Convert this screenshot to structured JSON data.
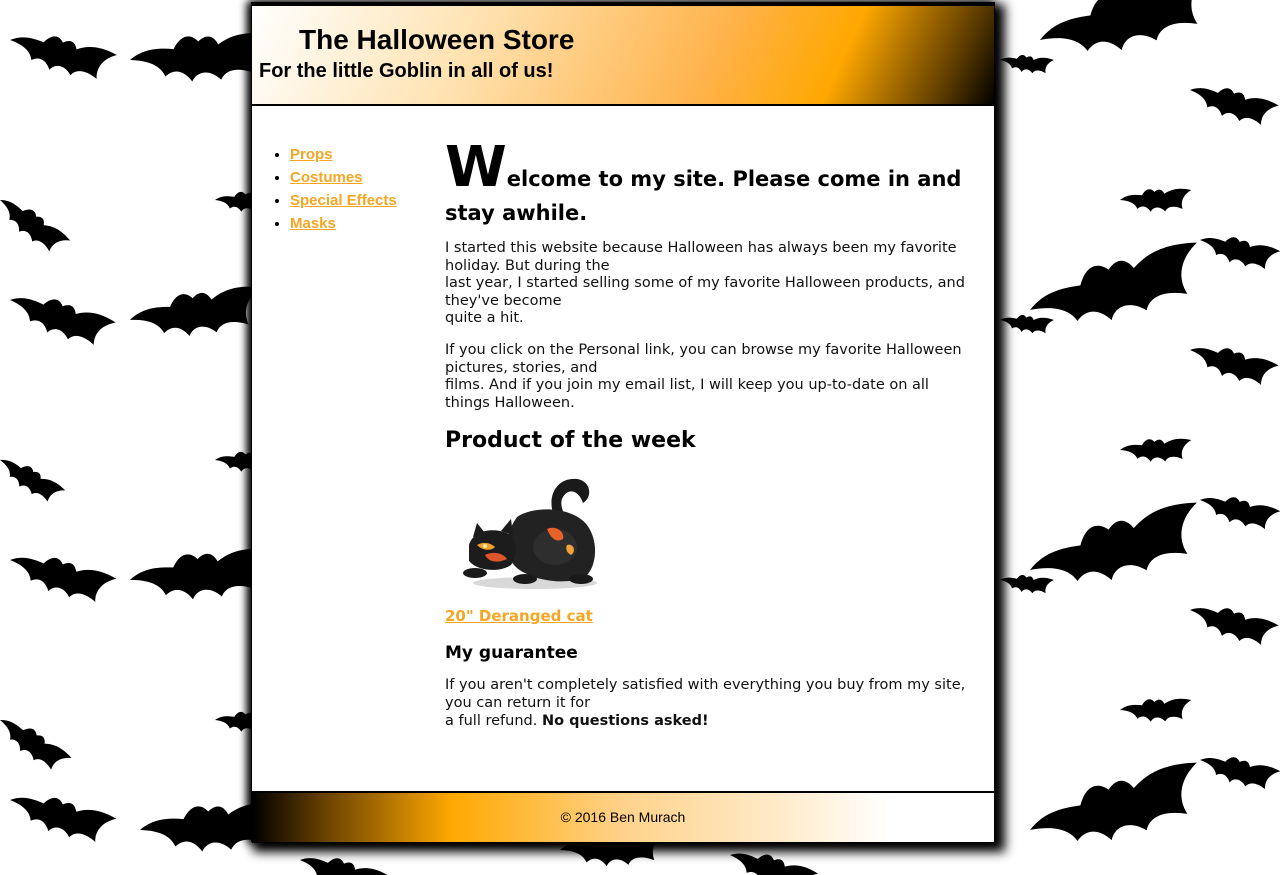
{
  "header": {
    "title": "The Halloween Store",
    "tagline": "For the little Goblin in all of us!"
  },
  "nav": {
    "items": [
      {
        "label": "Props"
      },
      {
        "label": "Costumes"
      },
      {
        "label": "Special Effects"
      },
      {
        "label": "Masks"
      }
    ]
  },
  "main": {
    "welcome_initial": "W",
    "welcome_rest": "elcome to my site. Please come in and stay awhile.",
    "para1": "I started this website because Halloween has always been my favorite holiday. But during the\nlast year, I started selling some of my favorite Halloween products, and they've become\nquite a hit.",
    "para2": "If you click on the Personal link, you can browse my favorite Halloween pictures, stories, and\nfilms. And if you join my email list, I will keep you up-to-date on all things Halloween.",
    "product_heading": "Product of the week",
    "product_link": "20\" Deranged cat",
    "guarantee_heading": "My guarantee",
    "guarantee_text": "If you aren't completely satisfied with everything you buy from my site, you can return it for\na full refund. ",
    "guarantee_bold": "No questions asked!"
  },
  "footer": {
    "copyright": "© 2016 Ben Murach"
  },
  "colors": {
    "link": "#f5a623",
    "accent": "#ffa800",
    "text": "#000000"
  },
  "icons": {
    "background": "bat-pattern",
    "product": "deranged-cat-image"
  }
}
